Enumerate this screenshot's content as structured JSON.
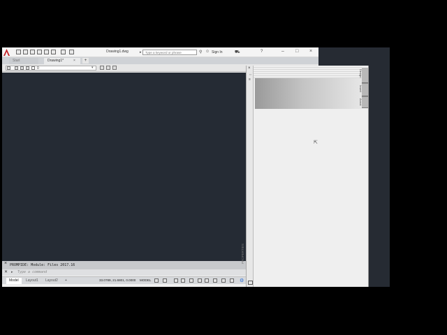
{
  "titlebar": {
    "document_title": "Drawing1.dwg",
    "search_placeholder": "Type a keyword or phrase",
    "signin_label": "Sign In",
    "minimize": "–",
    "maximize": "□",
    "close": "×"
  },
  "tabs": {
    "start_label": "Start",
    "drawing_label": "Drawing1*",
    "drawing_close": "×",
    "add_label": "+"
  },
  "toolbar": {
    "layer_value": "0"
  },
  "command": {
    "history_text": "PROMPIDE: Module: Files 2017.16",
    "input_placeholder": "Type a command",
    "close_glyph": "×"
  },
  "layout_tabs": {
    "model": "Model",
    "layout1": "Layout1",
    "layout2": "Layout2",
    "add": "+"
  },
  "status": {
    "coordinates": "33.0789, 21.6801, 0.0000",
    "space": "MODEL"
  },
  "palette": {
    "vertical_title": "PROPERTIES",
    "close_glyph": "×",
    "side_tabs": [
      "Design",
      "Insert",
      "Annot"
    ]
  },
  "colors": {
    "canvas": "#252b34",
    "logo_red": "#c41f24",
    "accent_blue": "#2a6ed6"
  }
}
